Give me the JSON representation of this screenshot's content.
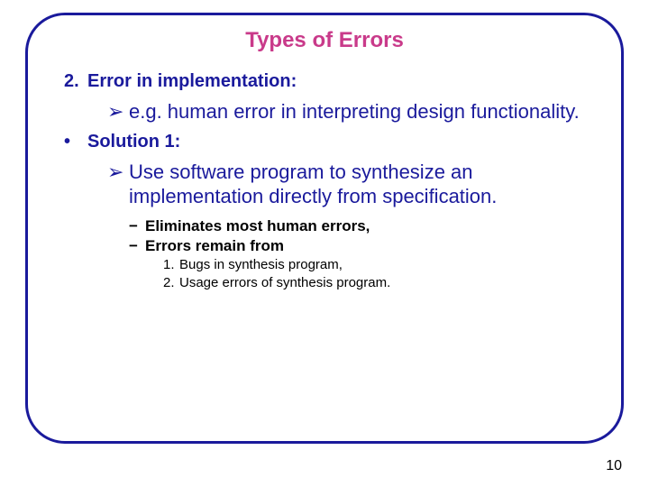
{
  "title": "Types of Errors",
  "section": {
    "num": "2.",
    "label": "Error in implementation:"
  },
  "section_sub": "e.g. human error in interpreting design functionality.",
  "solution": {
    "bullet": "•",
    "label": "Solution 1:"
  },
  "solution_sub": "Use software program to synthesize an implementation directly from specification.",
  "dash1": "Eliminates most human errors,",
  "dash2": "Errors remain from",
  "rem1": {
    "n": "1.",
    "t": "Bugs in synthesis program,"
  },
  "rem2": {
    "n": "2.",
    "t": "Usage errors of synthesis program."
  },
  "arrow": "➢",
  "dash": "−",
  "page": "10"
}
